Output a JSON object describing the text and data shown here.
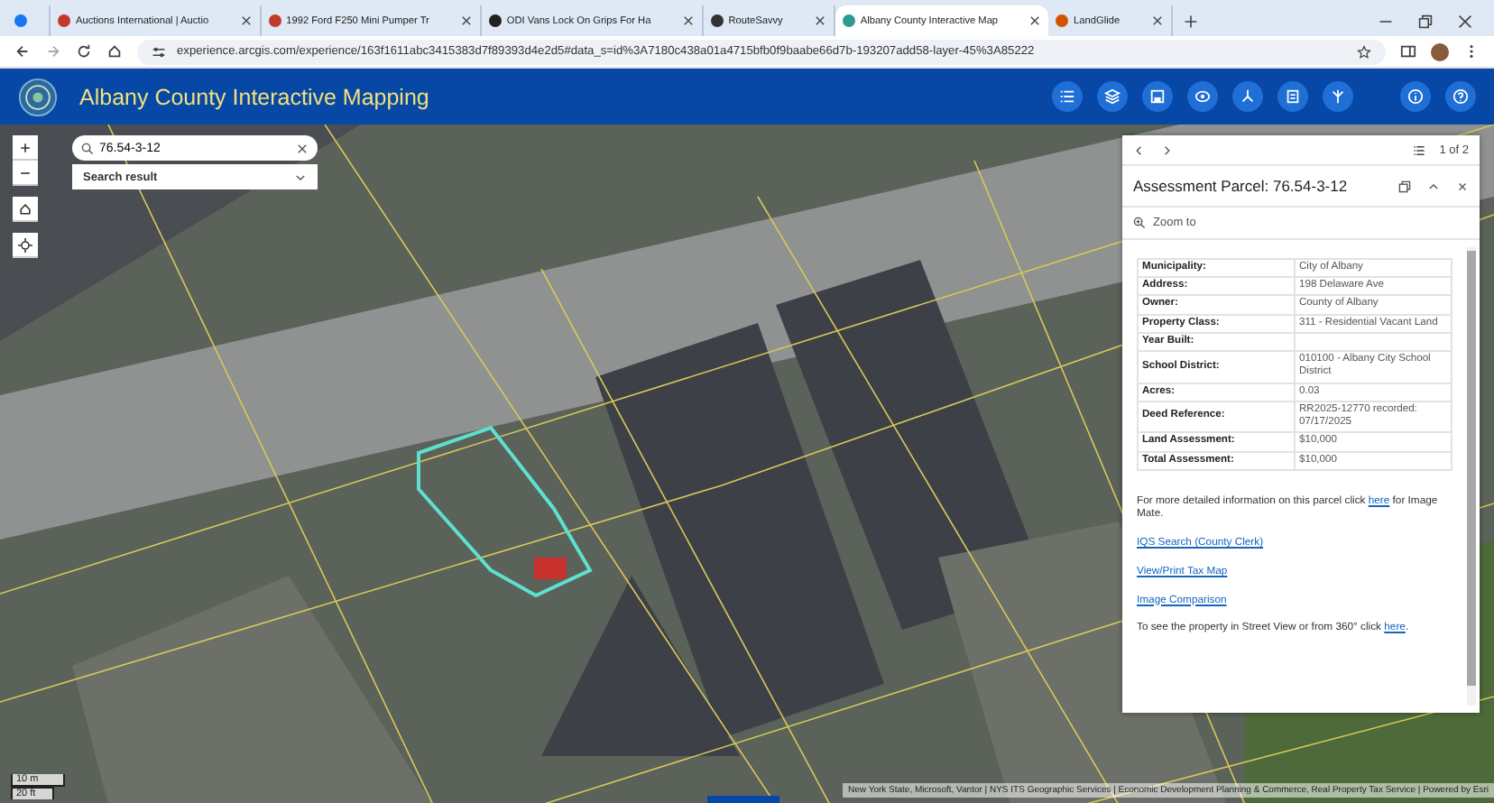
{
  "browser": {
    "tabs": [
      {
        "kind": "facebook",
        "selected": false
      },
      {
        "kind": "auction",
        "title": "Auctions International | Auctio",
        "selected": false
      },
      {
        "kind": "auction",
        "title": "1992 Ford F250 Mini Pumper Tr",
        "selected": false
      },
      {
        "kind": "odi",
        "title": "ODI Vans Lock On Grips For Ha",
        "selected": false
      },
      {
        "kind": "route",
        "title": "RouteSavvy",
        "selected": false
      },
      {
        "kind": "arcgis",
        "title": "Albany County Interactive Map",
        "selected": true
      },
      {
        "kind": "landglide",
        "title": "LandGlide",
        "selected": false
      }
    ],
    "url": "experience.arcgis.com/experience/163f1611abc3415383d7f89393d4e2d5#data_s=id%3A7180c438a01a4715bfb0f9baabe66d7b-193207add58-layer-45%3A85222"
  },
  "header": {
    "title": "Albany County Interactive Mapping"
  },
  "search": {
    "value": "76.54-3-12",
    "result_label": "Search result"
  },
  "panel": {
    "pager": "1 of 2",
    "title": "Assessment Parcel: 76.54-3-12",
    "zoom_to": "Zoom to",
    "rows": [
      {
        "label": "Municipality:",
        "value": "City of Albany"
      },
      {
        "label": "Address:",
        "value": "198 Delaware Ave"
      },
      {
        "label": "Owner:",
        "value": "County of Albany"
      },
      {
        "label": "Property Class:",
        "value": "311 - Residential Vacant Land"
      },
      {
        "label": "Year Built:"
      },
      {
        "label": "School District:",
        "value": "010100 - Albany City School District"
      },
      {
        "label": "Acres:",
        "value": "0.03"
      },
      {
        "label": "Deed Reference:",
        "value": "RR2025-12770 recorded: 07/17/2025"
      },
      {
        "label": "Land Assessment:",
        "value": "$10,000"
      },
      {
        "label": "Total Assessment:",
        "value": "$10,000"
      }
    ],
    "paragraphs": [
      [
        {
          "kind": "text",
          "text": "For more detailed information on this parcel click "
        },
        {
          "kind": "link",
          "text": "here"
        },
        {
          "kind": "text",
          "text": " for Image Mate."
        }
      ],
      [
        {
          "kind": "link",
          "text": "IQS Search (County Clerk)"
        }
      ],
      [
        {
          "kind": "link",
          "text": "View/Print Tax Map"
        }
      ],
      [
        {
          "kind": "link",
          "text": "Image Comparison"
        }
      ],
      [
        {
          "kind": "text",
          "text": "To see the property in Street View or from 360° click "
        },
        {
          "kind": "link",
          "text": "here"
        },
        {
          "kind": "text",
          "text": "."
        }
      ]
    ]
  },
  "scale": {
    "metric": "10 m",
    "imperial": "20 ft"
  },
  "attribution": "New York State, Microsoft, Vantor | NYS ITS Geographic Services | Economic Development Planning & Commerce, Real Property Tax Service | Powered by Esri"
}
